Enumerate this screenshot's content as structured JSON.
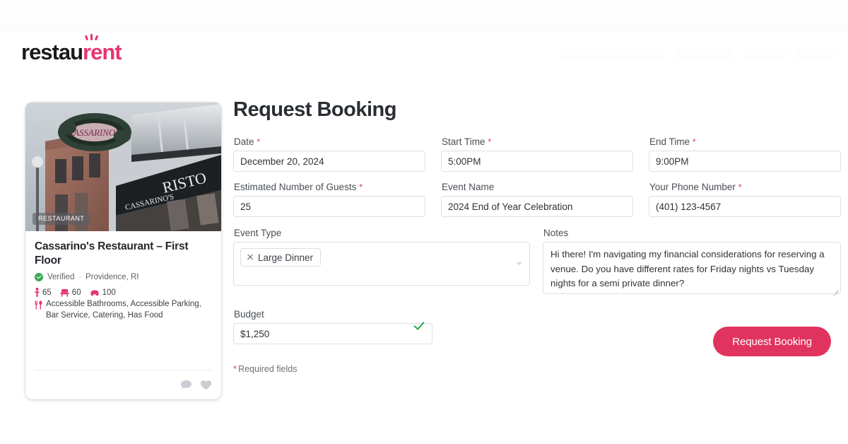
{
  "brand": {
    "logo_text_a": "restau",
    "logo_text_b": "rent",
    "accent_color": "#e5356f",
    "button_color": "#e0345f"
  },
  "venue_card": {
    "photo_badge": "RESTAURANT",
    "title": "Cassarino's Restaurant – First Floor",
    "verified_label": "Verified",
    "separator": "·",
    "location": "Providence, RI",
    "stats": [
      {
        "icon": "standing-person-icon",
        "value": "65"
      },
      {
        "icon": "seated-chair-icon",
        "value": "60"
      },
      {
        "icon": "parking-car-icon",
        "value": "100"
      }
    ],
    "amenities_icon": "cutlery-icon",
    "amenities": "Accessible Bathrooms, Accessible Parking, Bar Service, Catering, Has Food",
    "footer_icons": [
      "comment-bubble-icon",
      "heart-icon"
    ]
  },
  "form": {
    "title": "Request Booking",
    "required_marker": "*",
    "required_note": "Required fields",
    "fields": {
      "date": {
        "label": "Date",
        "required": true,
        "value": "December 20, 2024"
      },
      "start_time": {
        "label": "Start Time",
        "required": true,
        "value": "5:00PM"
      },
      "end_time": {
        "label": "End Time",
        "required": true,
        "value": "9:00PM"
      },
      "guests": {
        "label": "Estimated Number of Guests",
        "required": true,
        "value": "25"
      },
      "event_name": {
        "label": "Event Name",
        "required": false,
        "value": "2024 End of Year Celebration"
      },
      "phone": {
        "label": "Your Phone Number",
        "required": true,
        "value": "(401) 123-4567"
      },
      "event_type": {
        "label": "Event Type",
        "required": false,
        "selected": [
          "Large Dinner"
        ]
      },
      "notes": {
        "label": "Notes",
        "required": false,
        "value": "Hi there! I'm navigating my financial considerations for reserving a venue. Do you have different rates for Friday nights vs Tuesday nights for a semi private dinner?"
      },
      "budget": {
        "label": "Budget",
        "required": false,
        "value": "$1,250",
        "validation_icon": "green-check-icon"
      }
    },
    "submit_label": "Request Booking"
  }
}
